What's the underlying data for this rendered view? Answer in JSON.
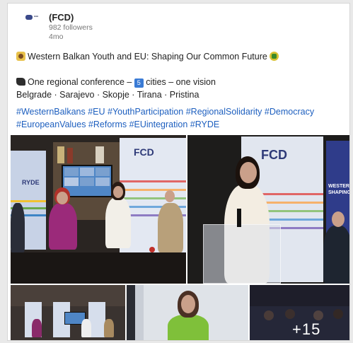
{
  "post": {
    "author": "(FCD)",
    "followers": "982 followers",
    "time": "4mo",
    "headline": "Western Balkan Youth and EU: Shaping Our Common Future",
    "conference_prefix": "One regional conference –",
    "cities_count": "5",
    "conference_suffix": "cities – one vision",
    "cities": "Belgrade · Sarajevo · Skopje · Tirana · Pristina",
    "hashtags_line1": "#WesternBalkans #EU #YouthParticipation #RegionalSolidarity #Democracy",
    "hashtags_line2": "#EuropeanValues #Reforms #EUintegration #RYDE"
  },
  "photos": {
    "banner_text": "FCD",
    "banner_side_text": "RYDE",
    "banner_right_text": "WESTERN SHAPING",
    "more_count": "+15"
  },
  "colors": {
    "hashtag": "#1d5fbf",
    "brand": "#2e3a78"
  }
}
